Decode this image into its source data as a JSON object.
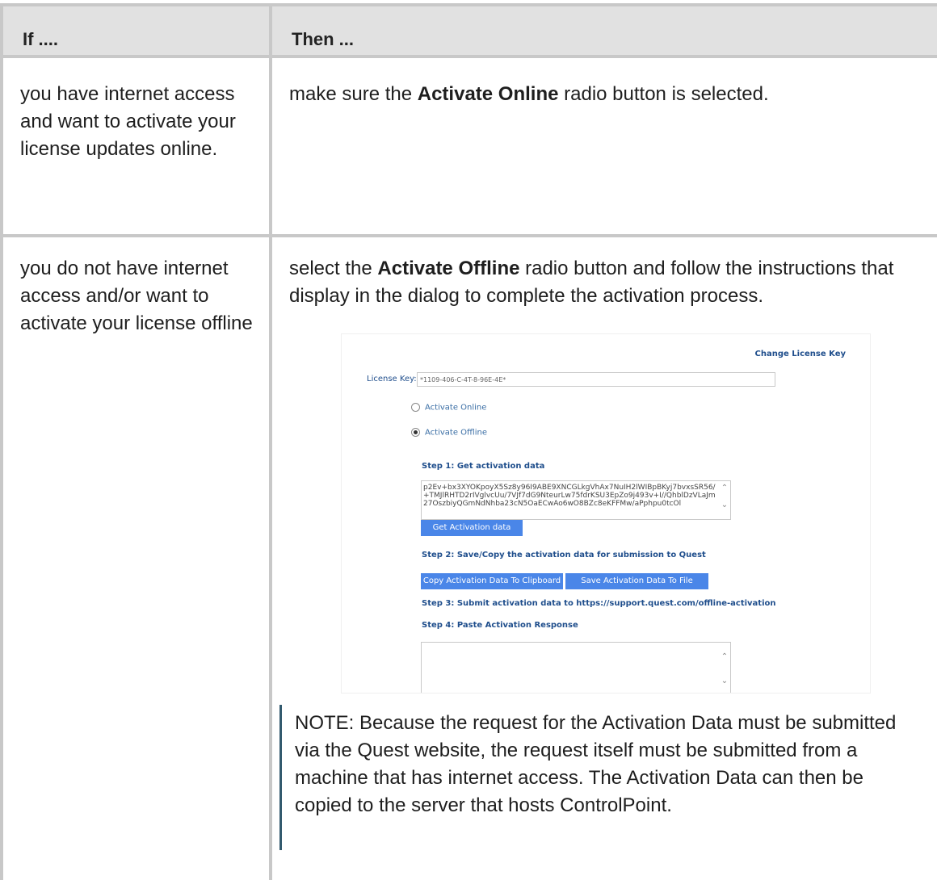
{
  "table": {
    "header": {
      "if": "If ....",
      "then": "Then ..."
    },
    "row1": {
      "if": "you have internet access and want to activate your license updates online.",
      "then_pre": "make sure the ",
      "then_bold": "Activate Online",
      "then_post": " radio button is selected."
    },
    "row2": {
      "if": "you do not have internet access and/or want to activate your license offline",
      "then_pre": "select the ",
      "then_bold": "Activate Offline",
      "then_post": " radio button and follow the instructions that display in the dialog to complete the activation process."
    }
  },
  "dialog": {
    "change_license_key": "Change License Key",
    "license_key_label": "License Key:",
    "license_key_value": "*1109-406-C-4T-8-96E-4E*",
    "radio_online": "Activate Online",
    "radio_offline": "Activate Offline",
    "selected": "offline",
    "step1": "Step 1: Get activation data",
    "activation_data": "p2Ev+bx3XYOKpoyX5Sz8y96I9ABE9XNCGLkgVhAx7NuIH2lWIBpBKyj7bvxsSR56/+TMJlRHTD2rIVglvcUu/7VJf7dG9NteurLw75fdrKSU3EpZo9j493v+I//QhblDzVLaJm27OszbiyQGmNdNhba23cN5OaECwAo6wO8BZc8eKFFMw/aPphpu0tcOl",
    "get_activation_button": "Get Activation data",
    "step2": "Step 2: Save/Copy the activation data for submission to Quest",
    "copy_button": "Copy Activation Data To Clipboard",
    "save_button": "Save Activation Data To File",
    "step3": "Step 3: Submit activation data to https://support.quest.com/offline-activation",
    "step4": "Step 4: Paste Activation Response",
    "response_value": ""
  },
  "note": "NOTE:  Because the request for the Activation Data must be submitted via the Quest website, the request itself must be submitted from a machine that has internet access.  The Activation Data can then be copied to the server that hosts ControlPoint."
}
